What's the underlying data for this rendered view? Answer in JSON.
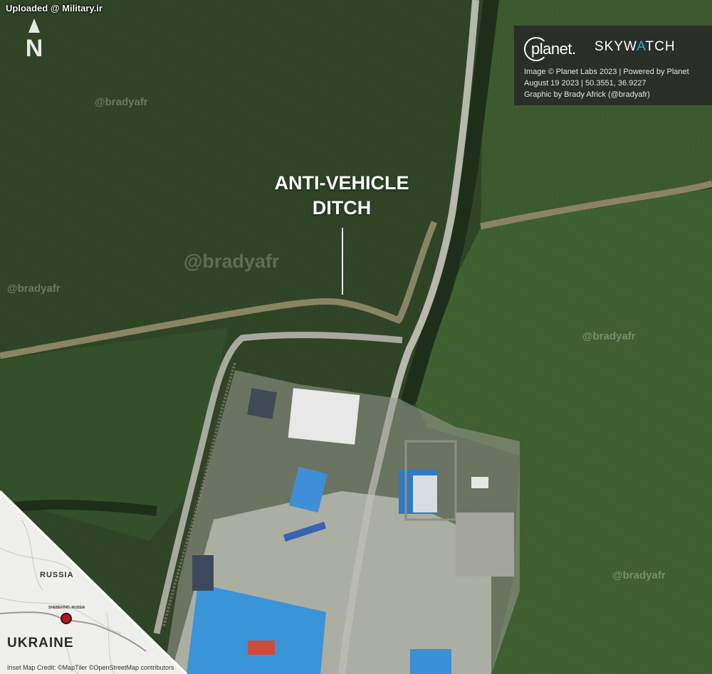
{
  "upload_tag": "Uploaded @ Military.ir",
  "north_arrow": {
    "letter": "N",
    "icon": "north-arrow-icon"
  },
  "annotation": {
    "line1": "ANTI-VEHICLE",
    "line2": "DITCH"
  },
  "watermarks": [
    "@bradyafr",
    "@bradyafr",
    "@bradyafr",
    "@bradyafr",
    "@bradyafr"
  ],
  "credit_panel": {
    "planet_logo": "planet.",
    "skywatch_logo_pre": "SKYW",
    "skywatch_logo_accent": "A",
    "skywatch_logo_post": "TCH",
    "line1": "Image © Planet Labs 2023 | Powered by Planet",
    "line2": "August 19 2023 | 50.3551, 36.9227",
    "line3": "Graphic by Brady Africk (@bradyafr)"
  },
  "inset_map": {
    "country_north": "RUSSIA",
    "country_south": "UKRAINE",
    "town": "SHEBEKINO, RUSSIA",
    "marker_color": "#c0121a",
    "credit": "Inset Map Credit: ©MapTiler ©OpenStreetMap contributors"
  },
  "colors": {
    "field_dark": "#2f4526",
    "field_light": "#3d5a2f",
    "ditch": "#8a8463",
    "road": "#b8b7ad",
    "roof_blue": "#3f8fd6",
    "roof_white": "#e8e8e8"
  }
}
